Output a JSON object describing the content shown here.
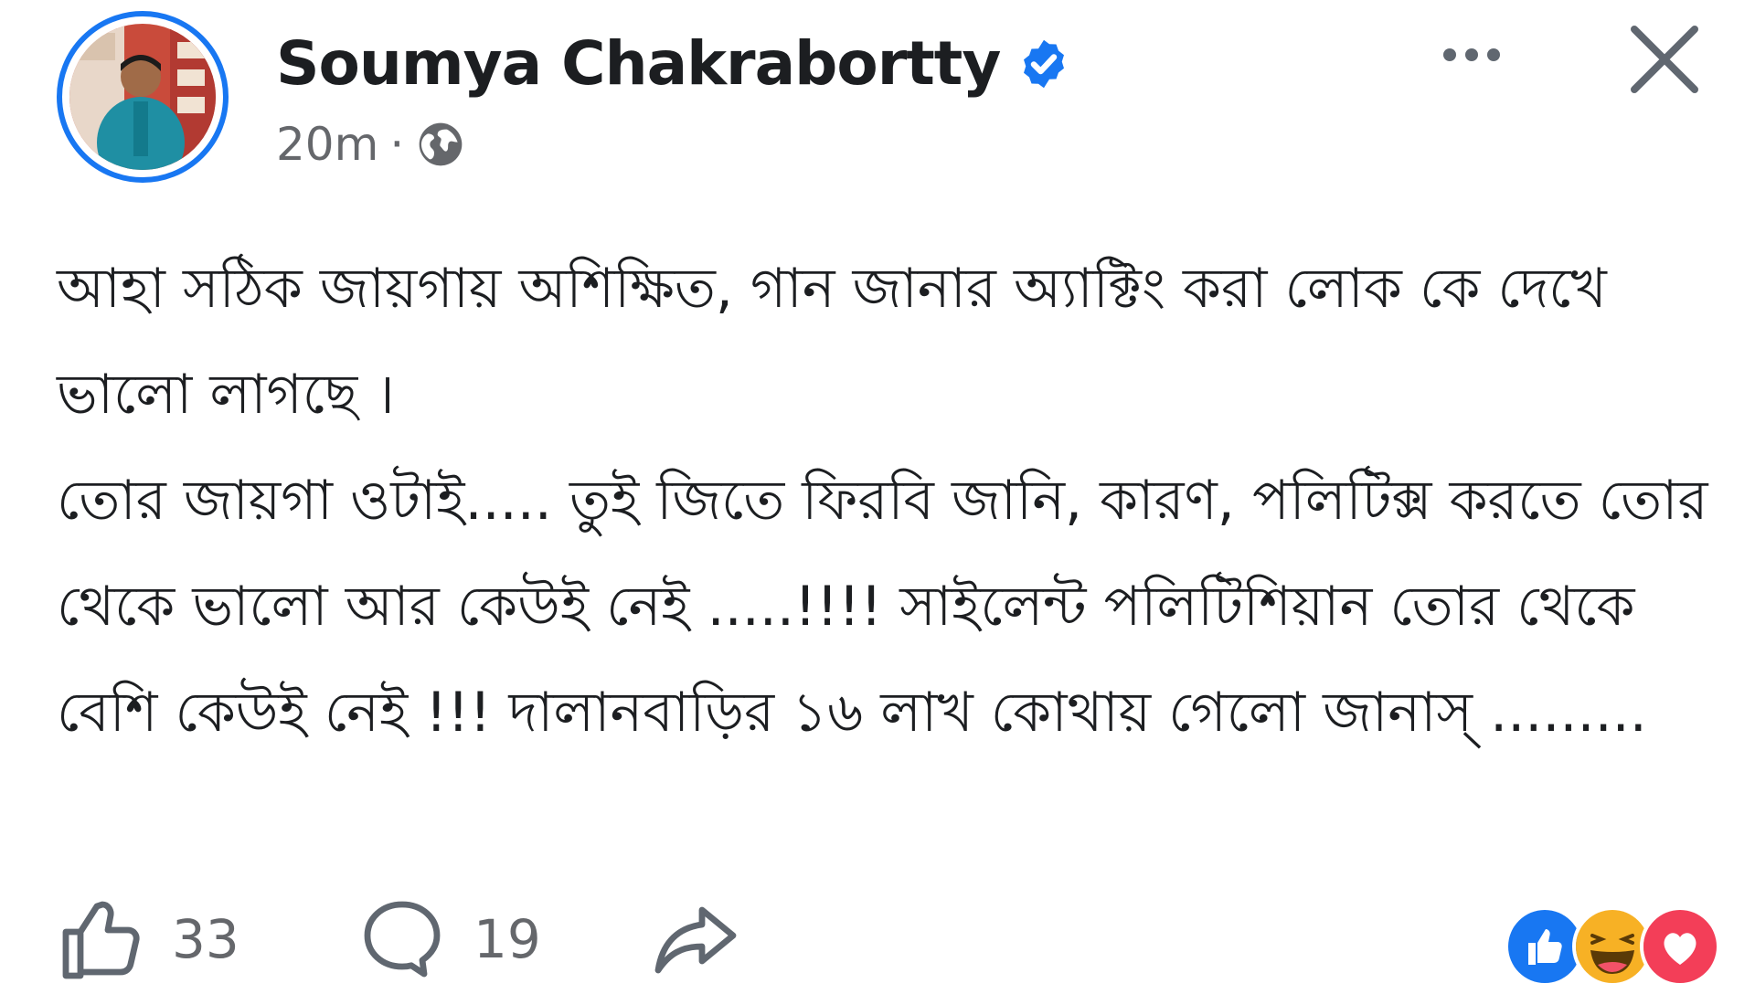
{
  "post": {
    "author": {
      "name": "Soumya Chakrabortty",
      "verified": true,
      "avatar_icon": "profile-photo"
    },
    "meta": {
      "time": "20m",
      "separator": "·",
      "audience_icon": "globe-icon"
    },
    "text": "আহা সঠিক জায়গায় অশিক্ষিত, গান জানার অ্যাক্টিং করা লোক কে দেখে ভালো লাগছে ।\nতোর জায়গা ওটাই..... তুই জিতে ফিরবি জানি, কারণ, পলিটিক্স করতে তোর থেকে ভালো আর কেউই নেই .....!!!! সাইলেন্ট পলিটিশিয়ান তোর থেকে বেশি কেউই নেই !!! দালানবাড়ির ১৬ লাখ কোথায় গেলো জানাস্ .........",
    "actions": {
      "like_count": "33",
      "comment_count": "19"
    },
    "reactions": [
      "like",
      "haha",
      "love"
    ]
  },
  "colors": {
    "accent": "#1877f2",
    "secondary_text": "#65676b",
    "love": "#f33e58",
    "haha": "#f7b125"
  }
}
